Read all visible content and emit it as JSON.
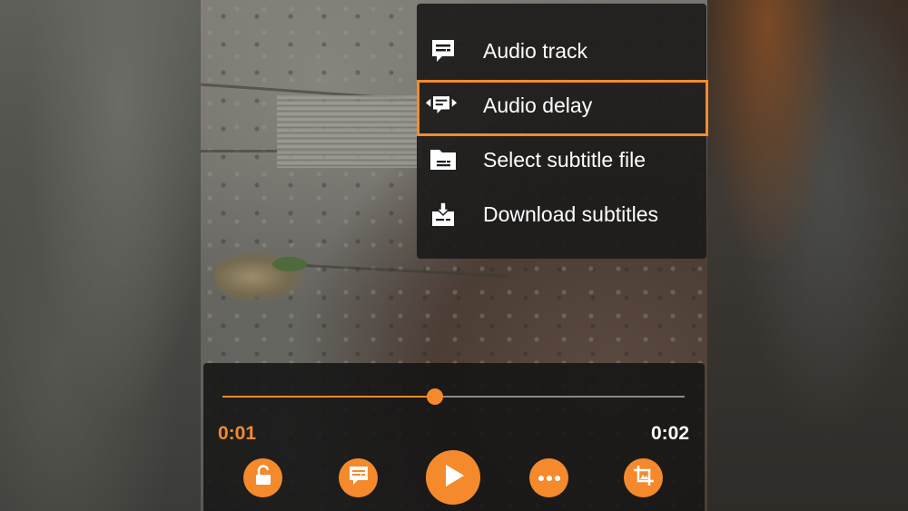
{
  "menu": {
    "items": [
      {
        "label": "Audio track",
        "icon": "subtitle-bubble-icon"
      },
      {
        "label": "Audio delay",
        "icon": "audio-delay-icon"
      },
      {
        "label": "Select subtitle file",
        "icon": "folder-subtitle-icon"
      },
      {
        "label": "Download subtitles",
        "icon": "download-subtitle-icon"
      }
    ],
    "highlighted": "Audio delay"
  },
  "player": {
    "current_time": "0:01",
    "total_time": "0:02",
    "progress": 0.46,
    "buttons": [
      {
        "name": "lock",
        "icon": "unlock-icon"
      },
      {
        "name": "subtitles",
        "icon": "subtitle-bubble-icon"
      },
      {
        "name": "play",
        "icon": "play-icon"
      },
      {
        "name": "more",
        "icon": "more-dots-icon"
      },
      {
        "name": "aspect-ratio",
        "icon": "crop-icon"
      }
    ]
  },
  "colors": {
    "accent": "#f58a2d",
    "menu_background": "#1c1b1a",
    "text": "#ffffff"
  }
}
